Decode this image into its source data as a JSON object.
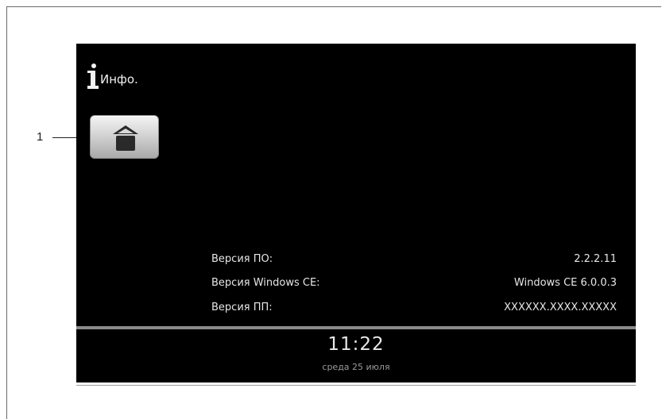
{
  "callout": {
    "number": "1"
  },
  "header": {
    "title": "Инфо."
  },
  "buttons": {
    "home_icon": "home-icon"
  },
  "info_rows": [
    {
      "label": "Версия ПО:",
      "value": "2.2.2.11"
    },
    {
      "label": "Версия Windows CE:",
      "value": "Windows CE 6.0.0.3"
    },
    {
      "label": "Версия ПП:",
      "value": "XXXXXX.XXXX.XXXXX"
    }
  ],
  "status_bar": {
    "time": "11:22",
    "date": "среда 25 июля"
  },
  "colors": {
    "screen_background": "#000000",
    "text": "#e6e6e6",
    "divider": "#8a8a8a",
    "button_top": "#f4f4f4",
    "button_bottom": "#a9a9a9"
  }
}
